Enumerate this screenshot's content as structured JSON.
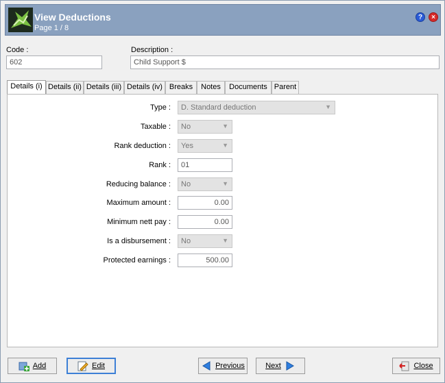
{
  "header": {
    "title": "View Deductions",
    "page": "Page 1 / 8",
    "help_symbol": "?",
    "close_symbol": "×"
  },
  "code": {
    "label": "Code :",
    "value": "602"
  },
  "description": {
    "label": "Description :",
    "value": "Child Support $"
  },
  "tabs": [
    {
      "label": "Details (i)",
      "active": true
    },
    {
      "label": "Details (ii)"
    },
    {
      "label": "Details (iii)"
    },
    {
      "label": "Details (iv)"
    },
    {
      "label": "Breaks"
    },
    {
      "label": "Notes"
    },
    {
      "label": "Documents"
    },
    {
      "label": "Parent"
    }
  ],
  "form": {
    "type": {
      "label": "Type :",
      "value": "D. Standard deduction"
    },
    "taxable": {
      "label": "Taxable :",
      "value": "No"
    },
    "rank_deduction": {
      "label": "Rank deduction :",
      "value": "Yes"
    },
    "rank": {
      "label": "Rank :",
      "value": "01"
    },
    "reducing_balance": {
      "label": "Reducing balance :",
      "value": "No"
    },
    "maximum_amount": {
      "label": "Maximum amount :",
      "value": "0.00"
    },
    "minimum_nett_pay": {
      "label": "Minimum nett pay :",
      "value": "0.00"
    },
    "is_disbursement": {
      "label": "Is a disbursement :",
      "value": "No"
    },
    "protected_earnings": {
      "label": "Protected earnings :",
      "value": "500.00"
    }
  },
  "buttons": {
    "add": "Add",
    "edit": "Edit",
    "previous": "Previous",
    "next": "Next",
    "close": "Close"
  }
}
